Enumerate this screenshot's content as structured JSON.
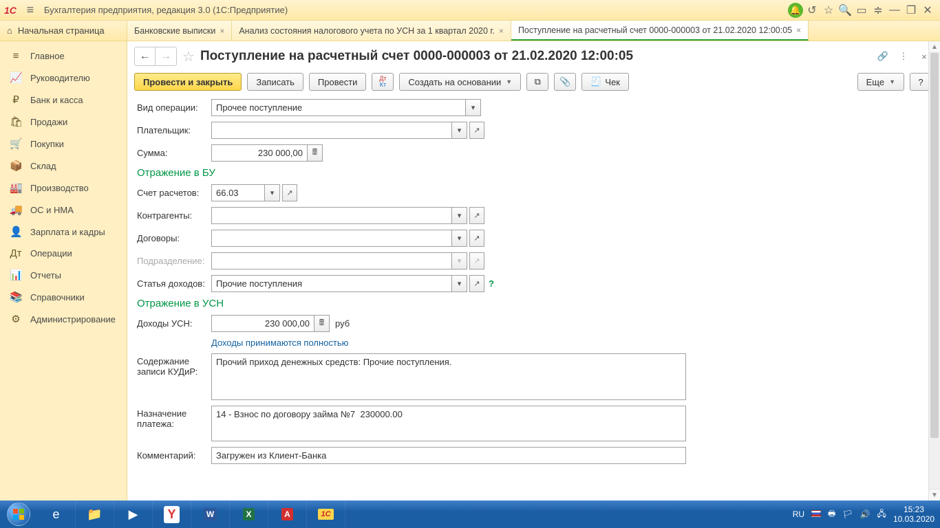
{
  "titlebar": {
    "app_title": "Бухгалтерия предприятия, редакция 3.0  (1С:Предприятие)"
  },
  "home_tab": "Начальная страница",
  "tabs": [
    {
      "label": "Банковские выписки",
      "active": false
    },
    {
      "label": "Анализ состояния налогового учета по УСН за 1 квартал 2020 г.",
      "active": false
    },
    {
      "label": "Поступление на расчетный счет 0000-000003 от 21.02.2020 12:00:05",
      "active": true
    }
  ],
  "sidebar": [
    {
      "icon": "≡",
      "label": "Главное"
    },
    {
      "icon": "📈",
      "label": "Руководителю"
    },
    {
      "icon": "₽",
      "label": "Банк и касса"
    },
    {
      "icon": "🛍",
      "label": "Продажи"
    },
    {
      "icon": "🛒",
      "label": "Покупки"
    },
    {
      "icon": "📦",
      "label": "Склад"
    },
    {
      "icon": "🏭",
      "label": "Производство"
    },
    {
      "icon": "🚚",
      "label": "ОС и НМА"
    },
    {
      "icon": "👤",
      "label": "Зарплата и кадры"
    },
    {
      "icon": "Дт",
      "label": "Операции"
    },
    {
      "icon": "📊",
      "label": "Отчеты"
    },
    {
      "icon": "📚",
      "label": "Справочники"
    },
    {
      "icon": "⚙",
      "label": "Администрирование"
    }
  ],
  "doc": {
    "title": "Поступление на расчетный счет 0000-000003 от 21.02.2020 12:00:05",
    "toolbar": {
      "post_close": "Провести и закрыть",
      "save": "Записать",
      "post": "Провести",
      "create_based": "Создать на основании",
      "check": "Чек",
      "more": "Еще",
      "help": "?"
    },
    "labels": {
      "op_type": "Вид операции:",
      "payer": "Плательщик:",
      "sum": "Сумма:",
      "section_bu": "Отражение в БУ",
      "account": "Счет расчетов:",
      "counterparty": "Контрагенты:",
      "contract": "Договоры:",
      "division": "Подразделение:",
      "income_item": "Статья доходов:",
      "section_usn": "Отражение в УСН",
      "income_usn": "Доходы УСН:",
      "currency": "руб",
      "income_full": "Доходы принимаются полностью",
      "kudir": "Содержание записи КУДиР:",
      "purpose": "Назначение платежа:",
      "comment": "Комментарий:"
    },
    "values": {
      "op_type": "Прочее поступление",
      "payer": "",
      "sum": "230 000,00",
      "account": "66.03",
      "counterparty": "",
      "contract": "",
      "division": "",
      "income_item": "Прочие поступления",
      "income_usn": "230 000,00",
      "kudir": "Прочий приход денежных средств: Прочие поступления.",
      "purpose": "14 - Взнос по договору займа №7  230000.00",
      "comment": "Загружен из Клиент-Банка"
    }
  },
  "tray": {
    "lang": "RU",
    "time": "15:23",
    "date": "10.03.2020"
  }
}
